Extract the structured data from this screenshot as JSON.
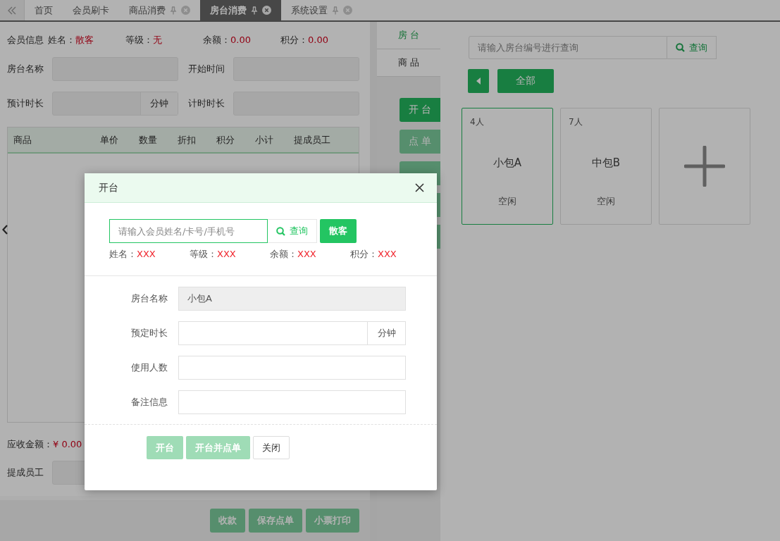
{
  "tabs": [
    {
      "label": "首页",
      "selected": false,
      "closable": false
    },
    {
      "label": "会员刷卡",
      "selected": false,
      "closable": false
    },
    {
      "label": "商品消费",
      "selected": false,
      "closable": true
    },
    {
      "label": "房台消费",
      "selected": true,
      "closable": true
    },
    {
      "label": "系统设置",
      "selected": false,
      "closable": true
    }
  ],
  "member_info": {
    "title": "会员信息",
    "items": [
      {
        "label": "姓名：",
        "value": "散客"
      },
      {
        "label": "等级：",
        "value": "无"
      },
      {
        "label": "余额：",
        "value": "0.00"
      },
      {
        "label": "积分：",
        "value": "0.00"
      }
    ]
  },
  "order_fields": [
    {
      "label": "房台名称"
    },
    {
      "label": "开始时间"
    },
    {
      "label": "预计时长",
      "unit": "分钟"
    },
    {
      "label": "计时时长"
    }
  ],
  "table": {
    "columns": [
      "商品",
      "单价",
      "数量",
      "折扣",
      "积分",
      "小计",
      "提成员工"
    ]
  },
  "amount_due": {
    "label": "应收金额：",
    "value": "¥ 0.00"
  },
  "staff_field": {
    "label": "提成员工"
  },
  "bottom_buttons": [
    {
      "label": "收款",
      "disabled": true
    },
    {
      "label": "保存点单",
      "disabled": true
    },
    {
      "label": "小票打印",
      "disabled": true
    }
  ],
  "side_tabs": [
    {
      "label": "房 台",
      "selected": true
    },
    {
      "label": "商 品",
      "selected": false
    }
  ],
  "side_buttons": [
    {
      "label": "开 台",
      "disabled": false
    },
    {
      "label": "点 单",
      "disabled": true
    },
    {
      "disabled": true
    },
    {
      "disabled": true
    },
    {
      "disabled": true
    }
  ],
  "room_search": {
    "placeholder": "请输入房台编号进行查询",
    "button": "查询"
  },
  "room_filter": {
    "label": "全部"
  },
  "rooms": [
    {
      "people": "4人",
      "name": "小包A",
      "status": "空闲",
      "selected": true
    },
    {
      "people": "7人",
      "name": "中包B",
      "status": "空闲",
      "selected": false
    }
  ],
  "dialog": {
    "title": "开台",
    "search": {
      "placeholder": "请输入会员姓名/卡号/手机号",
      "button": "查询",
      "guest_button": "散客"
    },
    "member": [
      {
        "label": "姓名：",
        "value": "XXX"
      },
      {
        "label": "等级：",
        "value": "XXX"
      },
      {
        "label": "余额：",
        "value": "XXX"
      },
      {
        "label": "积分：",
        "value": "XXX"
      }
    ],
    "fields": [
      {
        "label": "房台名称",
        "value": "小包A",
        "kind": "readonly"
      },
      {
        "label": "预定时长",
        "kind": "unit",
        "unit": "分钟"
      },
      {
        "label": "使用人数",
        "kind": "text"
      },
      {
        "label": "备注信息",
        "kind": "text"
      }
    ],
    "buttons": [
      {
        "label": "开台",
        "disabled": true,
        "kind": "primary"
      },
      {
        "label": "开台并点单",
        "disabled": true,
        "kind": "primary"
      },
      {
        "label": "关闭",
        "kind": "plain"
      }
    ]
  }
}
